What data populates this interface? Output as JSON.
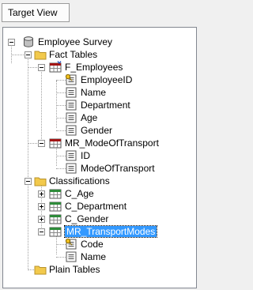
{
  "panel": {
    "title": "Target View"
  },
  "tree": {
    "root": "Employee Survey",
    "fact_tables": "Fact Tables",
    "f_employees": "F_Employees",
    "f_employees_fields": [
      "EmployeeID",
      "Name",
      "Department",
      "Age",
      "Gender"
    ],
    "mr_mode": "MR_ModeOfTransport",
    "mr_mode_fields": [
      "ID",
      "ModeOfTransport"
    ],
    "classifications": "Classifications",
    "c_age": "C_Age",
    "c_department": "C_Department",
    "c_gender": "C_Gender",
    "mr_transport_modes": "MR_TransportModes",
    "mr_transport_fields": [
      "Code",
      "Name"
    ],
    "plain_tables": "Plain Tables"
  },
  "colors": {
    "selection": "#3399ff",
    "folder": "#f2c94c",
    "table_green": "#2e8b3a",
    "table_red": "#a31515"
  }
}
